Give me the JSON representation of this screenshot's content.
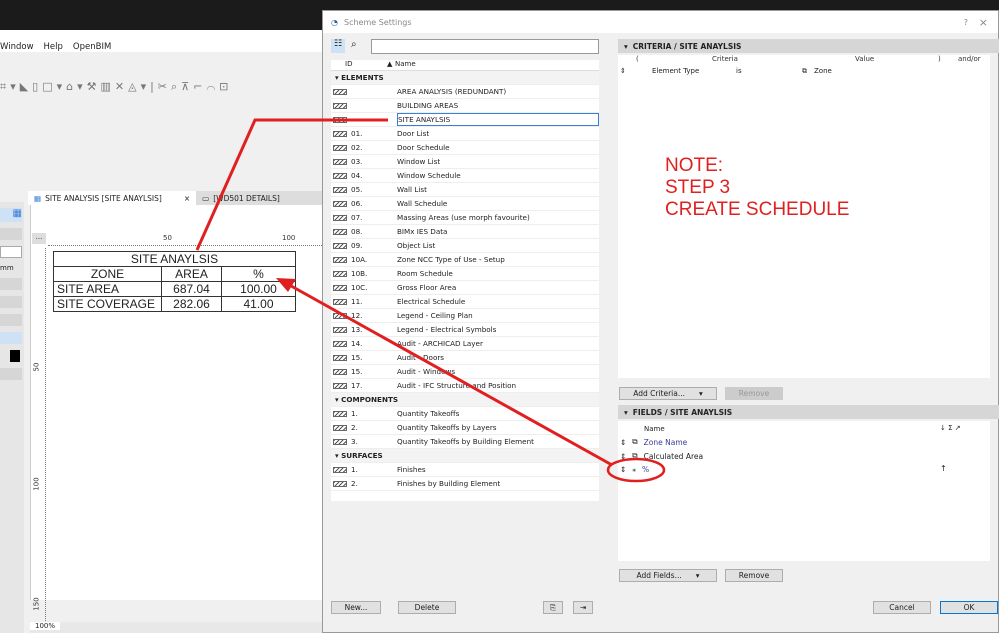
{
  "app": {
    "menu": [
      "Window",
      "Help",
      "OpenBIM"
    ],
    "tabs": [
      {
        "label": "SITE ANALYSIS [SITE ANAYLSIS]",
        "close": "×"
      },
      {
        "label": "[WD501 DETAILS]"
      }
    ],
    "ruler_top": [
      "50",
      "100"
    ],
    "ruler_left": [
      "50",
      "100",
      "150"
    ],
    "unit": "mm",
    "zoom": "100%",
    "ellipsis": "...",
    "schedule": {
      "title": "SITE ANAYLSIS",
      "headers": [
        "ZONE",
        "AREA",
        "%"
      ],
      "rows": [
        [
          "SITE AREA",
          "687.04",
          "100.00"
        ],
        [
          "SITE COVERAGE",
          "282.06",
          "41.00"
        ]
      ]
    }
  },
  "dialog": {
    "title": "Scheme Settings",
    "help": "?",
    "close": "×",
    "list": {
      "col_id": "ID",
      "col_name": "Name",
      "sections": [
        {
          "label": "ELEMENTS",
          "items": [
            [
              "",
              "AREA ANALYSIS (REDUNDANT)"
            ],
            [
              "",
              "BUILDING AREAS"
            ],
            [
              "",
              "SITE ANAYLSIS"
            ],
            [
              "01.",
              "Door List"
            ],
            [
              "02.",
              "Door Schedule"
            ],
            [
              "03.",
              "Window List"
            ],
            [
              "04.",
              "Window Schedule"
            ],
            [
              "05.",
              "Wall List"
            ],
            [
              "06.",
              "Wall Schedule"
            ],
            [
              "07.",
              "Massing Areas (use morph favourite)"
            ],
            [
              "08.",
              "BIMx IES Data"
            ],
            [
              "09.",
              "Object List"
            ],
            [
              "10A.",
              "Zone NCC Type of Use - Setup"
            ],
            [
              "10B.",
              "Room Schedule"
            ],
            [
              "10C.",
              "Gross Floor Area"
            ],
            [
              "11.",
              "Electrical Schedule"
            ],
            [
              "12.",
              "Legend - Ceiling Plan"
            ],
            [
              "13.",
              "Legend - Electrical Symbols"
            ],
            [
              "14.",
              "Audit - ARCHICAD Layer"
            ],
            [
              "15.",
              "Audit - Doors"
            ],
            [
              "15.",
              "Audit - Windows"
            ],
            [
              "17.",
              "Audit - IFC Structure and Position"
            ]
          ]
        },
        {
          "label": "COMPONENTS",
          "items": [
            [
              "1.",
              "Quantity Takeoffs"
            ],
            [
              "2.",
              "Quantity Takeoffs by Layers"
            ],
            [
              "3.",
              "Quantity Takeoffs by Building Element"
            ]
          ]
        },
        {
          "label": "SURFACES",
          "items": [
            [
              "1.",
              "Finishes"
            ],
            [
              "2.",
              "Finishes by Building Element"
            ]
          ]
        }
      ]
    },
    "new_label": "New...",
    "delete_label": "Delete",
    "criteria": {
      "header": "CRITERIA / SITE ANAYLSIS",
      "cols": [
        "(",
        "Criteria",
        "Value",
        ")",
        "and/or"
      ],
      "row": {
        "criteria": "Element Type",
        "op": "is",
        "value": "Zone"
      },
      "add": "Add Criteria...",
      "remove": "Remove"
    },
    "fields": {
      "header": "FIELDS / SITE ANAYLSIS",
      "col_name": "Name",
      "col_icons": "↓ Σ ↗",
      "items": [
        "Zone Name",
        "Calculated Area",
        "%"
      ],
      "sort_marker": "↑",
      "add": "Add Fields...",
      "remove": "Remove"
    },
    "cancel": "Cancel",
    "ok": "OK"
  },
  "annotation": {
    "lines": [
      "NOTE:",
      "STEP 3",
      "CREATE SCHEDULE"
    ],
    "color": "#e02020"
  }
}
